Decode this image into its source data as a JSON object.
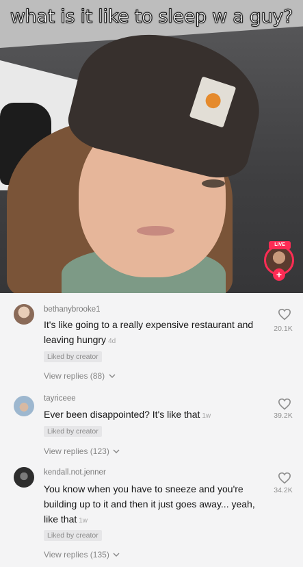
{
  "video": {
    "caption": "what is it like to sleep w a guy?",
    "live_badge": "LIVE",
    "live_plus": "+"
  },
  "comments": [
    {
      "username": "bethanybrooke1",
      "text": "It's like going to a really expensive restaurant and leaving hungry",
      "age": "4d",
      "liked_label": "Liked by creator",
      "replies": "View replies (88)",
      "likes": "20.1K",
      "avatar_color": "#c9a38c"
    },
    {
      "username": "tayriceee",
      "text": "Ever been disappointed? It's like that",
      "age": "1w",
      "liked_label": "Liked by creator",
      "replies": "View replies (123)",
      "likes": "39.2K",
      "avatar_color": "#9db7cf"
    },
    {
      "username": "kendall.not.jenner",
      "text": "You know when you have to sneeze and you're building up to it and then it just goes away... yeah, like that",
      "age": "1w",
      "liked_label": "Liked by creator",
      "replies": "View replies (135)",
      "likes": "34.2K",
      "avatar_color": "#2d2d2d"
    }
  ],
  "icons": {
    "heart": "heart-outline-icon",
    "chevron": "chevron-down-icon"
  }
}
